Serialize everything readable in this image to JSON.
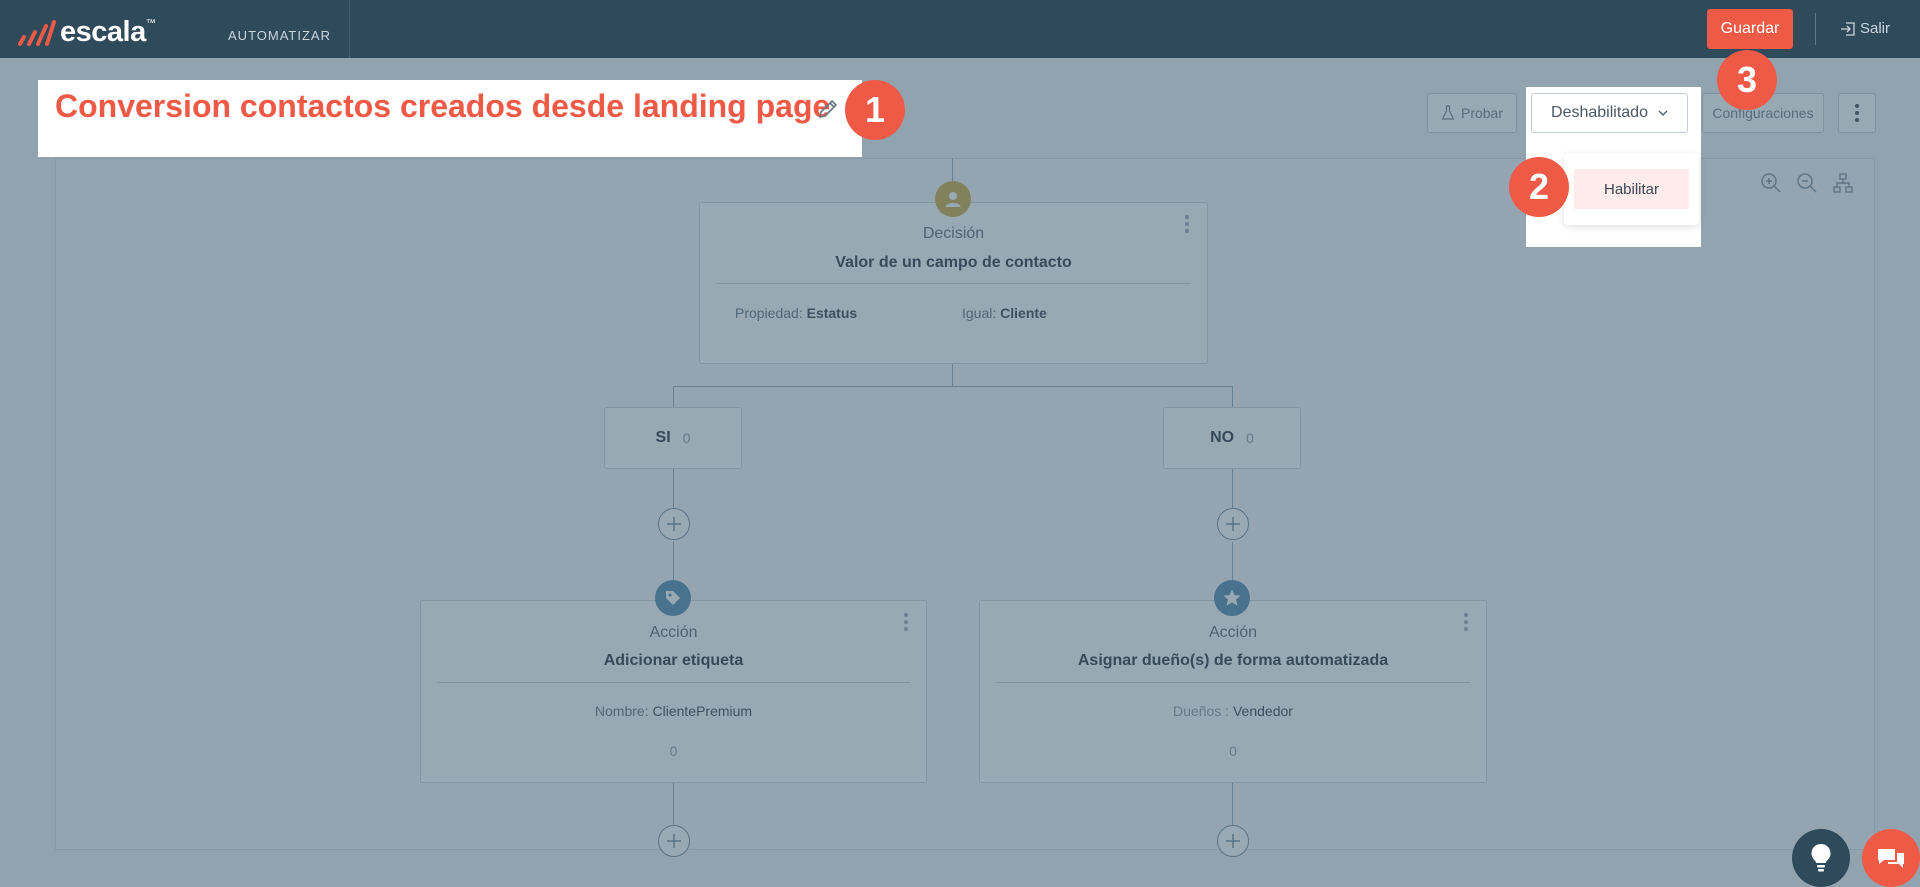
{
  "app": {
    "brand": "escala",
    "nav_item": "AUTOMATIZAR",
    "save_label": "Guardar",
    "exit_label": "Salir"
  },
  "flow": {
    "title": "Conversion contactos creados desde landing page"
  },
  "toolbar": {
    "test_label": "Probar",
    "status_value": "Deshabilitado",
    "status_option": "Habilitar",
    "config_label": "Configuraciones"
  },
  "decision": {
    "type": "Decisión",
    "name": "Valor de un campo de contacto",
    "prop_label": "Propiedad:",
    "prop_value": "Estatus",
    "eq_label": "Igual:",
    "eq_value": "Cliente"
  },
  "branches": [
    {
      "label": "SI",
      "count": "0"
    },
    {
      "label": "NO",
      "count": "0"
    }
  ],
  "actions": [
    {
      "type": "Acción",
      "name": "Adicionar etiqueta",
      "detail_label": "Nombre:",
      "detail_value": "ClientePremium",
      "count": "0"
    },
    {
      "type": "Acción",
      "name": "Asignar dueño(s) de forma automatizada",
      "detail_label": "Dueños :",
      "detail_value": "Vendedor",
      "count": "0"
    }
  ],
  "steps": [
    "1",
    "2",
    "3"
  ],
  "colors": {
    "accent": "#ef5a46",
    "topbar": "#2f4a5b",
    "decision_icon": "#c9a93a",
    "action_icon": "#4d86a8"
  }
}
